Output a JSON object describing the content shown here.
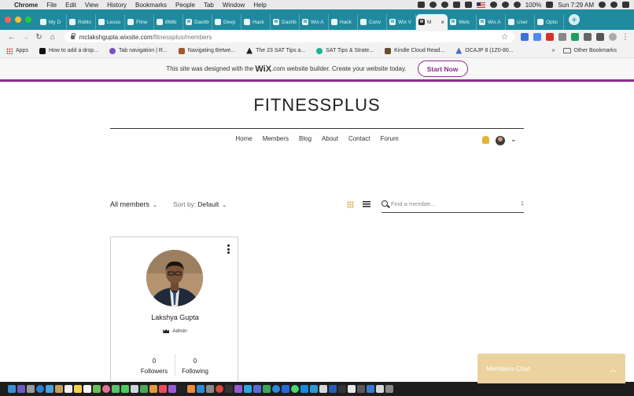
{
  "macos_menu": {
    "app": "Chrome",
    "items": [
      "File",
      "Edit",
      "View",
      "History",
      "Bookmarks",
      "People",
      "Tab",
      "Window",
      "Help"
    ],
    "battery": "100%",
    "clock": "Sun 7:29 AM"
  },
  "tabs": [
    {
      "label": "My D",
      "icon": "generic-favicon-icon"
    },
    {
      "label": "Roblo",
      "icon": "generic-favicon-icon"
    },
    {
      "label": "Lesso",
      "icon": "generic-favicon-icon"
    },
    {
      "label": "Fitne",
      "icon": "github-icon"
    },
    {
      "label": "868b",
      "icon": "generic-favicon-icon"
    },
    {
      "label": "Dashb",
      "icon": "wix-icon"
    },
    {
      "label": "Devp",
      "icon": "generic-favicon-icon"
    },
    {
      "label": "Hack",
      "icon": "generic-favicon-icon"
    },
    {
      "label": "Dashb",
      "icon": "wix-icon"
    },
    {
      "label": "Wix A",
      "icon": "wix-icon"
    },
    {
      "label": "Hack",
      "icon": "generic-favicon-icon"
    },
    {
      "label": "Conv",
      "icon": "generic-favicon-icon"
    },
    {
      "label": "Wix V",
      "icon": "wix-icon"
    },
    {
      "label": "M",
      "icon": "wix-icon",
      "active": true
    },
    {
      "label": "Welc",
      "icon": "wix-icon"
    },
    {
      "label": "Wix A",
      "icon": "wix-icon"
    },
    {
      "label": "User",
      "icon": "generic-favicon-icon"
    },
    {
      "label": "Optic",
      "icon": "github-icon"
    }
  ],
  "address": {
    "host": "mclakshgupta.wixsite.com",
    "path": "/fitnessplus/members"
  },
  "bookmarks": {
    "apps": "Apps",
    "items": [
      "How to add a drop...",
      "Tab navigation | R...",
      "Navigating Betwe...",
      "The 23 SAT Tips a...",
      "SAT Tips & Strate...",
      "Kindle Cloud Read...",
      "OCAJP 8 (1Z0-80..."
    ],
    "overflow": "»",
    "other": "Other Bookmarks"
  },
  "wix_banner": {
    "text_before": "This site was designed with the",
    "brand": "WiX",
    "brand_suffix": ".com",
    "text_after": "website builder. Create your website today.",
    "cta": "Start Now"
  },
  "site": {
    "title": "FITNESSPLUS",
    "nav": [
      "Home",
      "Members",
      "Blog",
      "About",
      "Contact",
      "Forum"
    ]
  },
  "members": {
    "filter": "All members",
    "sort_label": "Sort by:",
    "sort_value": "Default",
    "search_placeholder": "Find a member...",
    "search_count": "1",
    "cards": [
      {
        "name": "Lakshya Gupta",
        "role": "Admin",
        "followers": "0",
        "followers_label": "Followers",
        "following": "0",
        "following_label": "Following"
      }
    ]
  },
  "chat": {
    "label": "Members Chat"
  },
  "colors": {
    "wix_purple": "#8b2a8d",
    "chrome_teal": "#1f8a9e",
    "chat_gold": "#ecd29f"
  }
}
